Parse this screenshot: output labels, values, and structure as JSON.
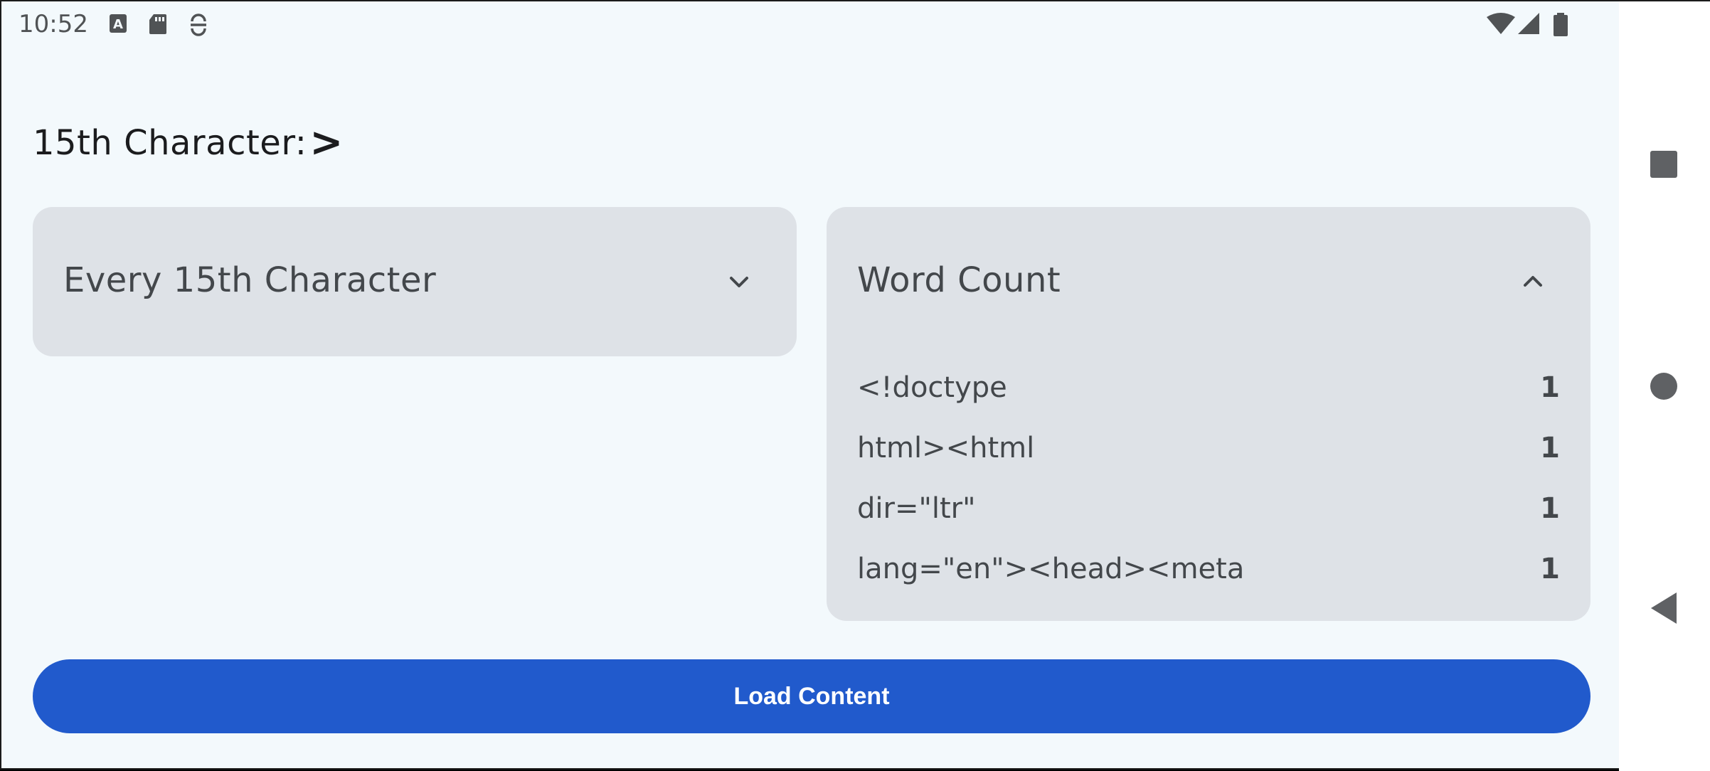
{
  "status_bar": {
    "time": "10:52",
    "icons_left": [
      "a-icon",
      "sd-card-icon",
      "sync-icon"
    ],
    "icons_right": [
      "wifi-icon",
      "cell-signal-icon",
      "battery-icon"
    ]
  },
  "header": {
    "label": "15th Character:",
    "value": ">"
  },
  "every_15th_card": {
    "title": "Every 15th Character",
    "expanded": false
  },
  "word_count_card": {
    "title": "Word Count",
    "expanded": true,
    "rows": [
      {
        "word": "<!doctype",
        "count": "1"
      },
      {
        "word": "html><html",
        "count": "1"
      },
      {
        "word": "dir=\"ltr\"",
        "count": "1"
      },
      {
        "word": "lang=\"en\"><head><meta",
        "count": "1"
      }
    ]
  },
  "load_button": {
    "label": "Load Content"
  },
  "nav": {
    "buttons": [
      "recents",
      "home",
      "back"
    ]
  },
  "colors": {
    "background": "#f3f9fc",
    "card": "#dee2e7",
    "primary": "#215acc",
    "text": "#43474b"
  }
}
